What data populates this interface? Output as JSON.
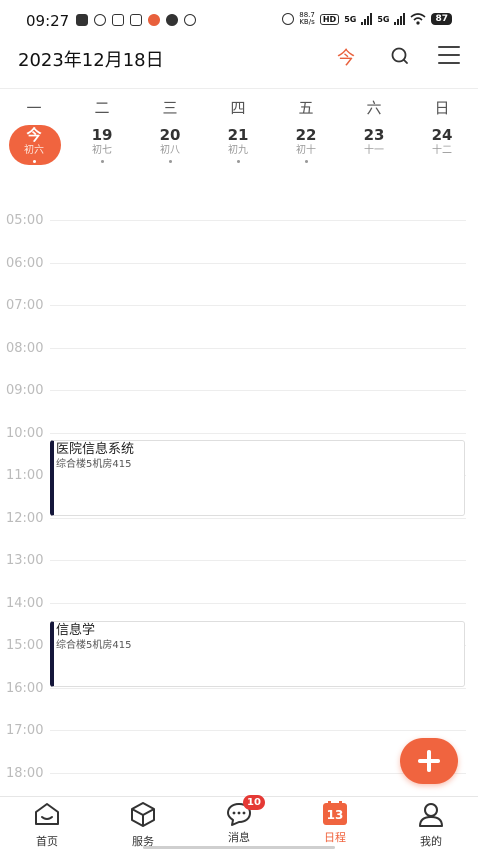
{
  "status_bar": {
    "time": "09:27",
    "net_speed_value": "88.7",
    "net_speed_unit": "KB/s",
    "hd_tag": "HD",
    "sig1": "5G",
    "sig2": "5G",
    "battery": "87"
  },
  "header": {
    "date": "2023年12月18日",
    "today_label": "今"
  },
  "week": {
    "days": [
      {
        "weekday": "一",
        "num": "今",
        "lunar": "初六",
        "today": true
      },
      {
        "weekday": "二",
        "num": "19",
        "lunar": "初七"
      },
      {
        "weekday": "三",
        "num": "20",
        "lunar": "初八"
      },
      {
        "weekday": "四",
        "num": "21",
        "lunar": "初九"
      },
      {
        "weekday": "五",
        "num": "22",
        "lunar": "初十"
      },
      {
        "weekday": "六",
        "num": "23",
        "lunar": "十一"
      },
      {
        "weekday": "日",
        "num": "24",
        "lunar": "十二"
      }
    ]
  },
  "timeline": {
    "hours": [
      "05:00",
      "06:00",
      "07:00",
      "08:00",
      "09:00",
      "10:00",
      "11:00",
      "12:00",
      "13:00",
      "14:00",
      "15:00",
      "16:00",
      "17:00",
      "18:00"
    ]
  },
  "events": [
    {
      "title": "医院信息系统",
      "location": "综合楼5机房415",
      "start": "10:00",
      "end": "12:00"
    },
    {
      "title": "信息学",
      "location": "综合楼5机房415",
      "start": "14:00",
      "end": "16:00"
    }
  ],
  "bottom_nav": {
    "items": [
      {
        "label": "首页",
        "icon": "home-icon"
      },
      {
        "label": "服务",
        "icon": "cube-icon"
      },
      {
        "label": "消息",
        "icon": "chat-icon",
        "badge": "10"
      },
      {
        "label": "日程",
        "icon": "calendar-icon",
        "active": true,
        "icon_text": "13"
      },
      {
        "label": "我的",
        "icon": "person-icon"
      }
    ]
  },
  "colors": {
    "accent": "#f0643f",
    "event_bar": "#14163a",
    "badge": "#e53935"
  }
}
